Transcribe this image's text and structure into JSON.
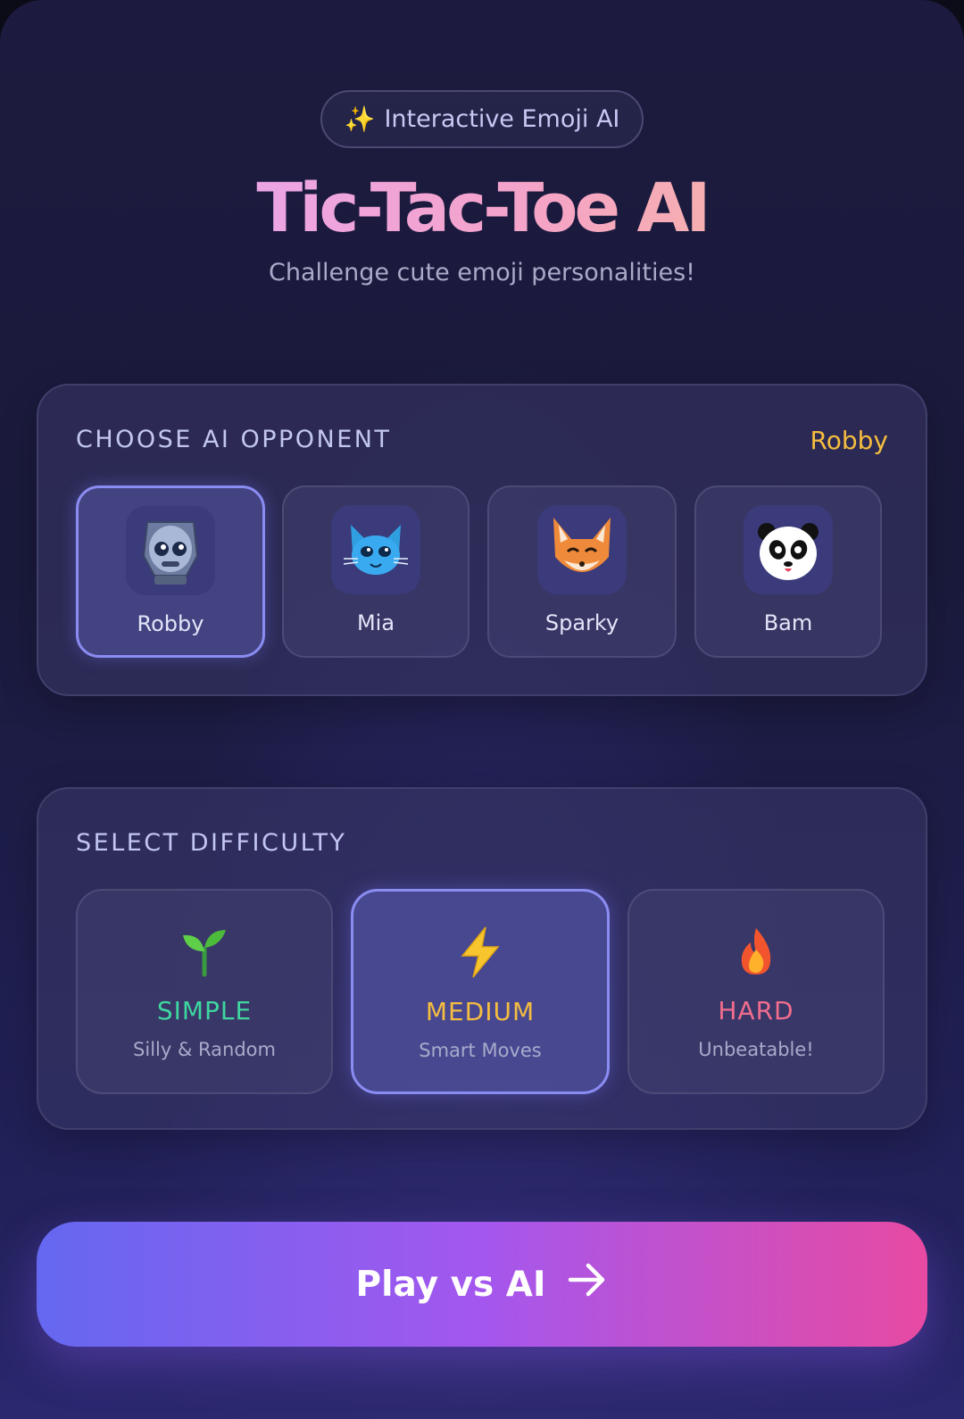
{
  "header": {
    "badge_icon": "sparkles-icon",
    "badge_label": "Interactive Emoji AI",
    "title": "Tic-Tac-Toe AI",
    "subtitle": "Challenge cute emoji personalities!"
  },
  "opponents": {
    "heading": "CHOOSE AI OPPONENT",
    "selected": "Robby",
    "items": [
      {
        "name": "Robby",
        "icon": "robot-icon",
        "active": true
      },
      {
        "name": "Mia",
        "icon": "cat-icon",
        "active": false
      },
      {
        "name": "Sparky",
        "icon": "fox-icon",
        "active": false
      },
      {
        "name": "Bam",
        "icon": "panda-icon",
        "active": false
      }
    ]
  },
  "difficulty": {
    "heading": "SELECT DIFFICULTY",
    "items": [
      {
        "label": "SIMPLE",
        "sub": "Silly & Random",
        "icon": "seedling-icon",
        "color": "#3fd6a0",
        "active": false
      },
      {
        "label": "MEDIUM",
        "sub": "Smart Moves",
        "icon": "lightning-icon",
        "color": "#f5bd3f",
        "active": true
      },
      {
        "label": "HARD",
        "sub": "Unbeatable!",
        "icon": "fire-icon",
        "color": "#f26d8d",
        "active": false
      }
    ]
  },
  "play_button": {
    "label": "Play vs AI",
    "icon": "arrow-right-icon"
  },
  "colors": {
    "accent_yellow": "#f5bd3f",
    "button_gradient_start": "#6468f0",
    "button_gradient_end": "#e74aa2"
  }
}
